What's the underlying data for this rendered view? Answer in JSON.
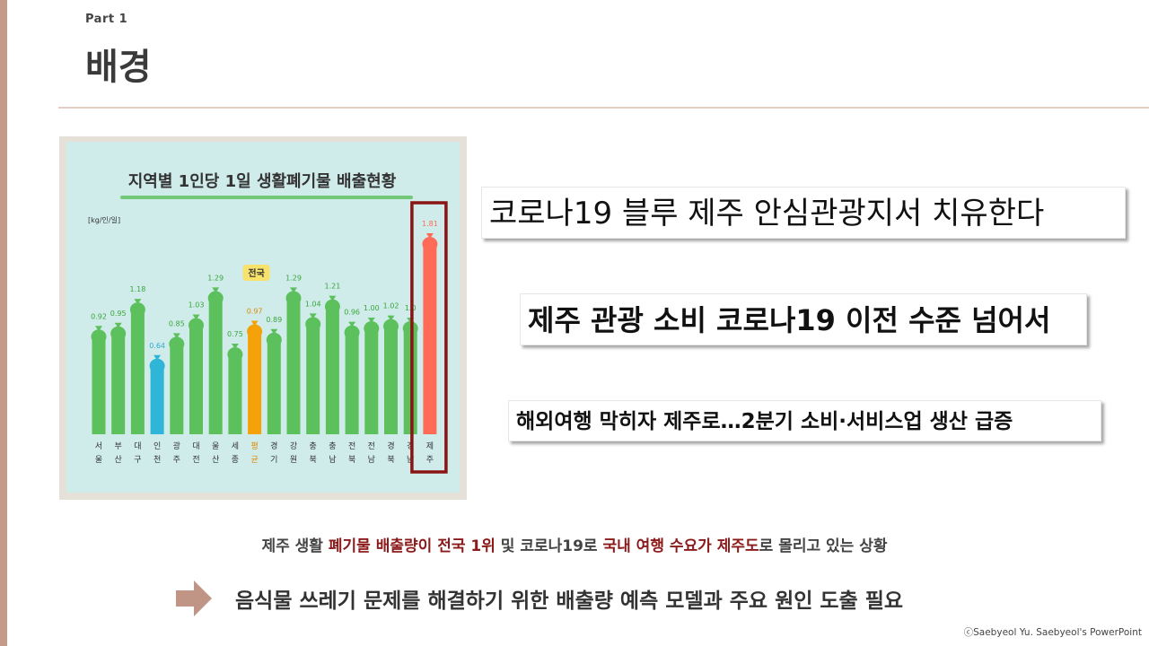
{
  "slide": {
    "part_label": "Part 1",
    "title": "배경",
    "headlines": [
      "코로나19 블루 제주 안심관광지서 치유한다",
      "제주 관광 소비 코로나19 이전 수준 넘어서",
      "해외여행 막히자 제주로…2분기 소비·서비스업 생산 급증"
    ],
    "summary": {
      "part1": "제주 생활 ",
      "part2": "폐기물 배출량이 전국 1위",
      "part3": " 및 코로나19로 ",
      "part4": "국내 여행 수요가 제주도",
      "part5": "로 몰리고 있는 상황"
    },
    "conclusion": "음식물 쓰레기 문제를 해결하기 위한 배출량 예측 모델과 주요 원인 도출 필요",
    "copyright": "ⓒSaebyeol Yu. Saebyeol's PowerPoint",
    "colors": {
      "left_bar": "#c49a8a",
      "highlight": "#8b1a1a",
      "bar_default": "#5cc05c",
      "bar_incheon": "#2fb5d8",
      "bar_national": "#f5a20a",
      "bar_jeju": "#ff6b57",
      "jeju_box": "#8a1414",
      "national_badge": "#f7e26b"
    }
  },
  "chart_data": {
    "type": "bar",
    "title": "지역별 1인당 1일 생활폐기물 배출현황",
    "ylabel": "[kg/인/일]",
    "national_badge": "전국",
    "categories": [
      [
        "서",
        "울"
      ],
      [
        "부",
        "산"
      ],
      [
        "대",
        "구"
      ],
      [
        "인",
        "천"
      ],
      [
        "광",
        "주"
      ],
      [
        "대",
        "전"
      ],
      [
        "울",
        "산"
      ],
      [
        "세",
        "종"
      ],
      [
        "평",
        "균"
      ],
      [
        "경",
        "기"
      ],
      [
        "강",
        "원"
      ],
      [
        "충",
        "북"
      ],
      [
        "충",
        "남"
      ],
      [
        "전",
        "북"
      ],
      [
        "전",
        "남"
      ],
      [
        "경",
        "북"
      ],
      [
        "경",
        "남"
      ],
      [
        "제",
        "주"
      ]
    ],
    "values": [
      0.92,
      0.95,
      1.18,
      0.64,
      0.85,
      1.03,
      1.29,
      0.75,
      0.97,
      0.89,
      1.29,
      1.04,
      1.21,
      0.96,
      1.0,
      1.02,
      1.0,
      1.81
    ],
    "value_labels": [
      "0.92",
      "0.95",
      "1.18",
      "0.64",
      "0.85",
      "1.03",
      "1.29",
      "0.75",
      "0.97",
      "0.89",
      "1.29",
      "1.04",
      "1.21",
      "0.96",
      "1.00",
      "1.02",
      "1.0",
      "1.81"
    ],
    "bar_kinds": [
      "default",
      "default",
      "default",
      "incheon",
      "default",
      "default",
      "default",
      "default",
      "national",
      "default",
      "default",
      "default",
      "default",
      "default",
      "default",
      "default",
      "default",
      "jeju"
    ],
    "ylim": [
      0,
      2.0
    ],
    "grid": false
  }
}
